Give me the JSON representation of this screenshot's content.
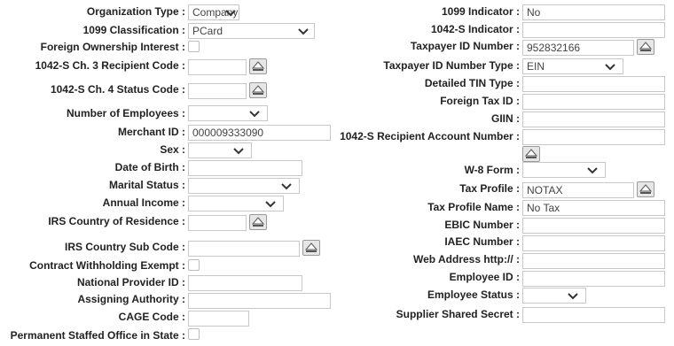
{
  "left": {
    "organization_type": {
      "label": "Organization Type :",
      "value": "Company"
    },
    "classification_1099": {
      "label": "1099 Classification :",
      "value": "PCard"
    },
    "foreign_ownership": {
      "label": "Foreign Ownership Interest :"
    },
    "ch3_recipient_code": {
      "label": "1042-S Ch. 3 Recipient Code :",
      "value": ""
    },
    "ch4_status_code": {
      "label": "1042-S Ch. 4 Status Code :",
      "value": ""
    },
    "num_employees": {
      "label": "Number of Employees :",
      "value": ""
    },
    "merchant_id": {
      "label": "Merchant ID :",
      "value": "000009333090"
    },
    "sex": {
      "label": "Sex :",
      "value": ""
    },
    "date_of_birth": {
      "label": "Date of Birth :",
      "value": ""
    },
    "marital_status": {
      "label": "Marital Status :",
      "value": ""
    },
    "annual_income": {
      "label": "Annual Income :",
      "value": ""
    },
    "irs_country": {
      "label": "IRS Country of Residence :",
      "value": ""
    },
    "irs_country_sub": {
      "label": "IRS Country Sub Code :",
      "value": ""
    },
    "contract_withholding": {
      "label": "Contract Withholding Exempt :"
    },
    "national_provider_id": {
      "label": "National Provider ID :",
      "value": ""
    },
    "assigning_authority": {
      "label": "Assigning Authority :",
      "value": ""
    },
    "cage_code": {
      "label": "CAGE Code :",
      "value": ""
    },
    "permanent_staffed": {
      "label": "Permanent Staffed Office in State :"
    }
  },
  "right": {
    "indicator_1099": {
      "label": "1099 Indicator :",
      "value": "No"
    },
    "indicator_1042s": {
      "label": "1042-S Indicator :",
      "value": ""
    },
    "taxpayer_id": {
      "label": "Taxpayer ID Number :",
      "value": "952832166"
    },
    "taxpayer_id_type": {
      "label": "Taxpayer ID Number Type :",
      "value": "EIN"
    },
    "detailed_tin_type": {
      "label": "Detailed TIN Type :",
      "value": ""
    },
    "foreign_tax_id": {
      "label": "Foreign Tax ID :",
      "value": ""
    },
    "giin": {
      "label": "GIIN :",
      "value": ""
    },
    "recipient_account": {
      "label": "1042-S Recipient Account Number :",
      "value": ""
    },
    "w8_form": {
      "label": "W-8 Form :",
      "value": ""
    },
    "tax_profile": {
      "label": "Tax Profile :",
      "value": "NOTAX"
    },
    "tax_profile_name": {
      "label": "Tax Profile Name :",
      "value": "No Tax"
    },
    "ebic_number": {
      "label": "EBIC Number :",
      "value": ""
    },
    "iaec_number": {
      "label": "IAEC Number :",
      "value": ""
    },
    "web_address": {
      "label": "Web Address http:// :",
      "value": ""
    },
    "employee_id": {
      "label": "Employee ID :",
      "value": ""
    },
    "employee_status": {
      "label": "Employee Status :",
      "value": ""
    },
    "supplier_secret": {
      "label": "Supplier Shared Secret :",
      "value": ""
    }
  },
  "icons": {
    "lookup": "lookup-icon",
    "dropdown": "chevron-down-icon"
  },
  "colors": {
    "border": "#c8c8c8",
    "text": "#222222",
    "button_bg": "#e6e6e6"
  }
}
